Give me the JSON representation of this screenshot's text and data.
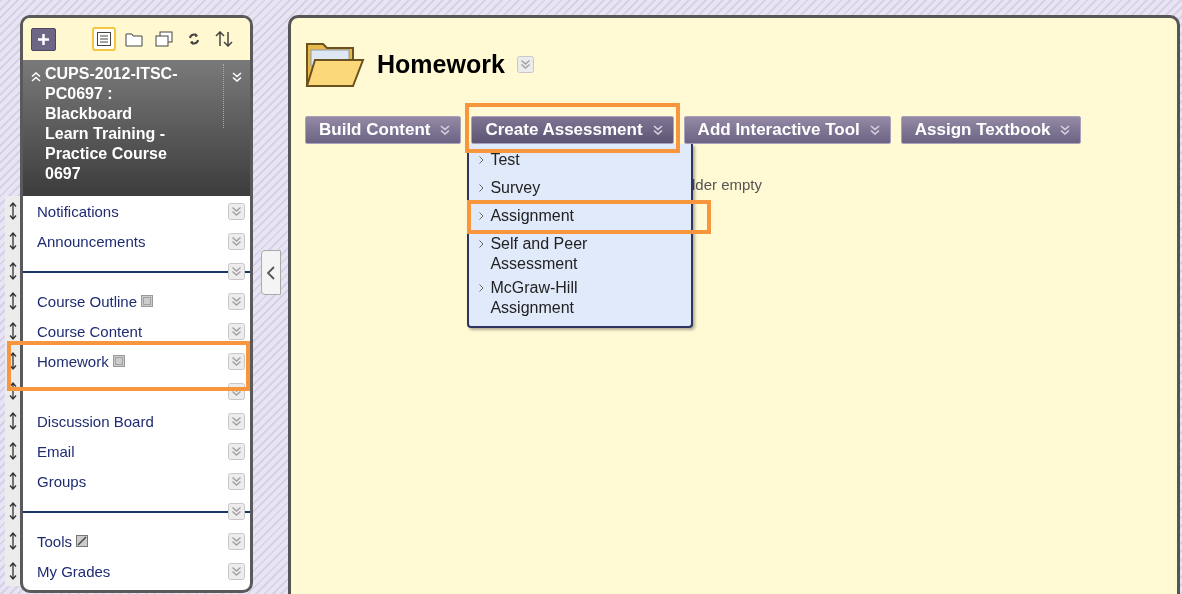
{
  "sidebar": {
    "tools": [
      {
        "kind": "list",
        "selected": true
      },
      {
        "kind": "folder",
        "selected": false
      },
      {
        "kind": "windows",
        "selected": false
      },
      {
        "kind": "refresh",
        "selected": false
      },
      {
        "kind": "sort",
        "selected": false
      }
    ],
    "course_title": "CUPS-2012-ITSC-PC0697 : Blackboard Learn Training - Practice Course 0697",
    "items": [
      {
        "kind": "link",
        "label": "Notifications",
        "empty": false,
        "hidden": false,
        "highlighted": false
      },
      {
        "kind": "link",
        "label": "Announcements",
        "empty": false,
        "hidden": false,
        "highlighted": false
      },
      {
        "kind": "divider"
      },
      {
        "kind": "link",
        "label": "Course Outline",
        "empty": true,
        "hidden": false,
        "highlighted": false
      },
      {
        "kind": "link",
        "label": "Course Content",
        "empty": false,
        "hidden": false,
        "highlighted": false
      },
      {
        "kind": "link",
        "label": "Homework",
        "empty": true,
        "hidden": false,
        "highlighted": true
      },
      {
        "kind": "blank"
      },
      {
        "kind": "link",
        "label": "Discussion Board",
        "empty": false,
        "hidden": false,
        "highlighted": false
      },
      {
        "kind": "link",
        "label": "Email",
        "empty": false,
        "hidden": false,
        "highlighted": false
      },
      {
        "kind": "link",
        "label": "Groups",
        "empty": false,
        "hidden": false,
        "highlighted": false
      },
      {
        "kind": "divider"
      },
      {
        "kind": "link",
        "label": "Tools",
        "empty": false,
        "hidden": true,
        "highlighted": false
      },
      {
        "kind": "link",
        "label": "My Grades",
        "empty": false,
        "hidden": false,
        "highlighted": false
      }
    ]
  },
  "page": {
    "title": "Homework",
    "buttons": [
      {
        "label": "Build Content",
        "highlighted": false,
        "expanded": false
      },
      {
        "label": "Create Assessment",
        "highlighted": true,
        "expanded": true,
        "menu": [
          {
            "label": "Test",
            "highlighted": false
          },
          {
            "label": "Survey",
            "highlighted": false
          },
          {
            "label": "Assignment",
            "highlighted": true
          },
          {
            "label": "Self and Peer Assessment",
            "highlighted": false
          },
          {
            "label": "McGraw-Hill Assignment",
            "highlighted": false
          }
        ]
      },
      {
        "label": "Add Interactive Tool",
        "highlighted": false,
        "expanded": false
      },
      {
        "label": "Assign Textbook",
        "highlighted": false,
        "expanded": false
      }
    ],
    "empty_message": "lder empty"
  }
}
